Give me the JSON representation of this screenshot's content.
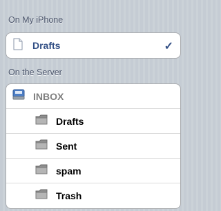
{
  "sections": [
    {
      "header": "On My iPhone",
      "items": [
        {
          "label": "Drafts",
          "icon": "document-icon",
          "selected": true,
          "check": "✓"
        }
      ]
    },
    {
      "header": "On the Server",
      "items": [
        {
          "label": "INBOX",
          "icon": "inbox-tray-icon",
          "disabled": true
        },
        {
          "label": "Drafts",
          "icon": "folder-icon",
          "indent": true
        },
        {
          "label": "Sent",
          "icon": "folder-icon",
          "indent": true
        },
        {
          "label": "spam",
          "icon": "folder-icon",
          "indent": true
        },
        {
          "label": "Trash",
          "icon": "folder-icon",
          "indent": true
        }
      ]
    }
  ],
  "colors": {
    "selected_text": "#324f85",
    "disabled_text": "#7f7f7f",
    "header_text": "#4c566c"
  }
}
